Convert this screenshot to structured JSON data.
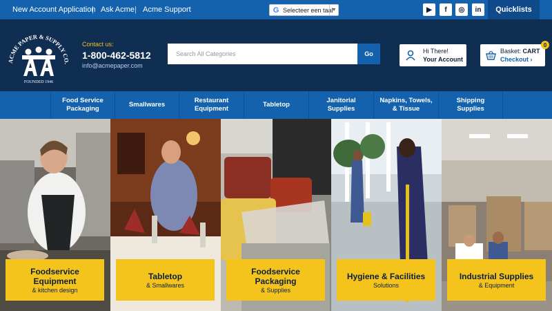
{
  "topbar": {
    "links": [
      "New Account Application",
      "Ask Acme",
      "Acme Support"
    ],
    "separator": "|",
    "translate_label": "Selecteer een taal",
    "translate_caret": "▼",
    "translate_g": "G",
    "social": [
      {
        "icon": "youtube-icon",
        "glyph": "▶"
      },
      {
        "icon": "facebook-icon",
        "glyph": "f"
      },
      {
        "icon": "instagram-icon",
        "glyph": "◎"
      },
      {
        "icon": "linkedin-icon",
        "glyph": "in"
      }
    ],
    "quicklists": "Quicklists"
  },
  "header": {
    "logo_text_top": "ACME PAPER & SUPPLY CO., INC.",
    "logo_text_bottom": "FOUNDED 1946",
    "contact_label": "Contact us:",
    "phone": "1-800-462-5812",
    "email": "info@acmepaper.com",
    "search_placeholder": "Search All Categories",
    "search_button": "Go",
    "account_line1": "Hi There!",
    "account_line2": "Your Account",
    "basket_line1": "Basket:",
    "basket_line1_bold": "CART",
    "basket_line2": "Checkout ›",
    "basket_count": "0"
  },
  "nav": [
    [
      "Food Service",
      "Packaging"
    ],
    [
      "Smallwares"
    ],
    [
      "Restaurant",
      "Equipment"
    ],
    [
      "Tabletop"
    ],
    [
      "Janitorial",
      "Supplies"
    ],
    [
      "Napkins, Towels,",
      "& Tissue"
    ],
    [
      "Shipping",
      "Supplies"
    ]
  ],
  "tiles": [
    {
      "title": [
        "Foodservice",
        "Equipment"
      ],
      "subtitle": "& kitchen design"
    },
    {
      "title": [
        "Tabletop"
      ],
      "subtitle": "& Smallwares"
    },
    {
      "title": [
        "Foodservice",
        "Packaging"
      ],
      "subtitle": "& Supplies"
    },
    {
      "title": [
        "Hygiene & Facilities"
      ],
      "subtitle": "Solutions"
    },
    {
      "title": [
        "Industrial Supplies"
      ],
      "subtitle": "& Equipment"
    }
  ],
  "colors": {
    "brand_blue": "#1462ad",
    "header_navy": "#102d52",
    "accent_yellow": "#f4c41d"
  }
}
